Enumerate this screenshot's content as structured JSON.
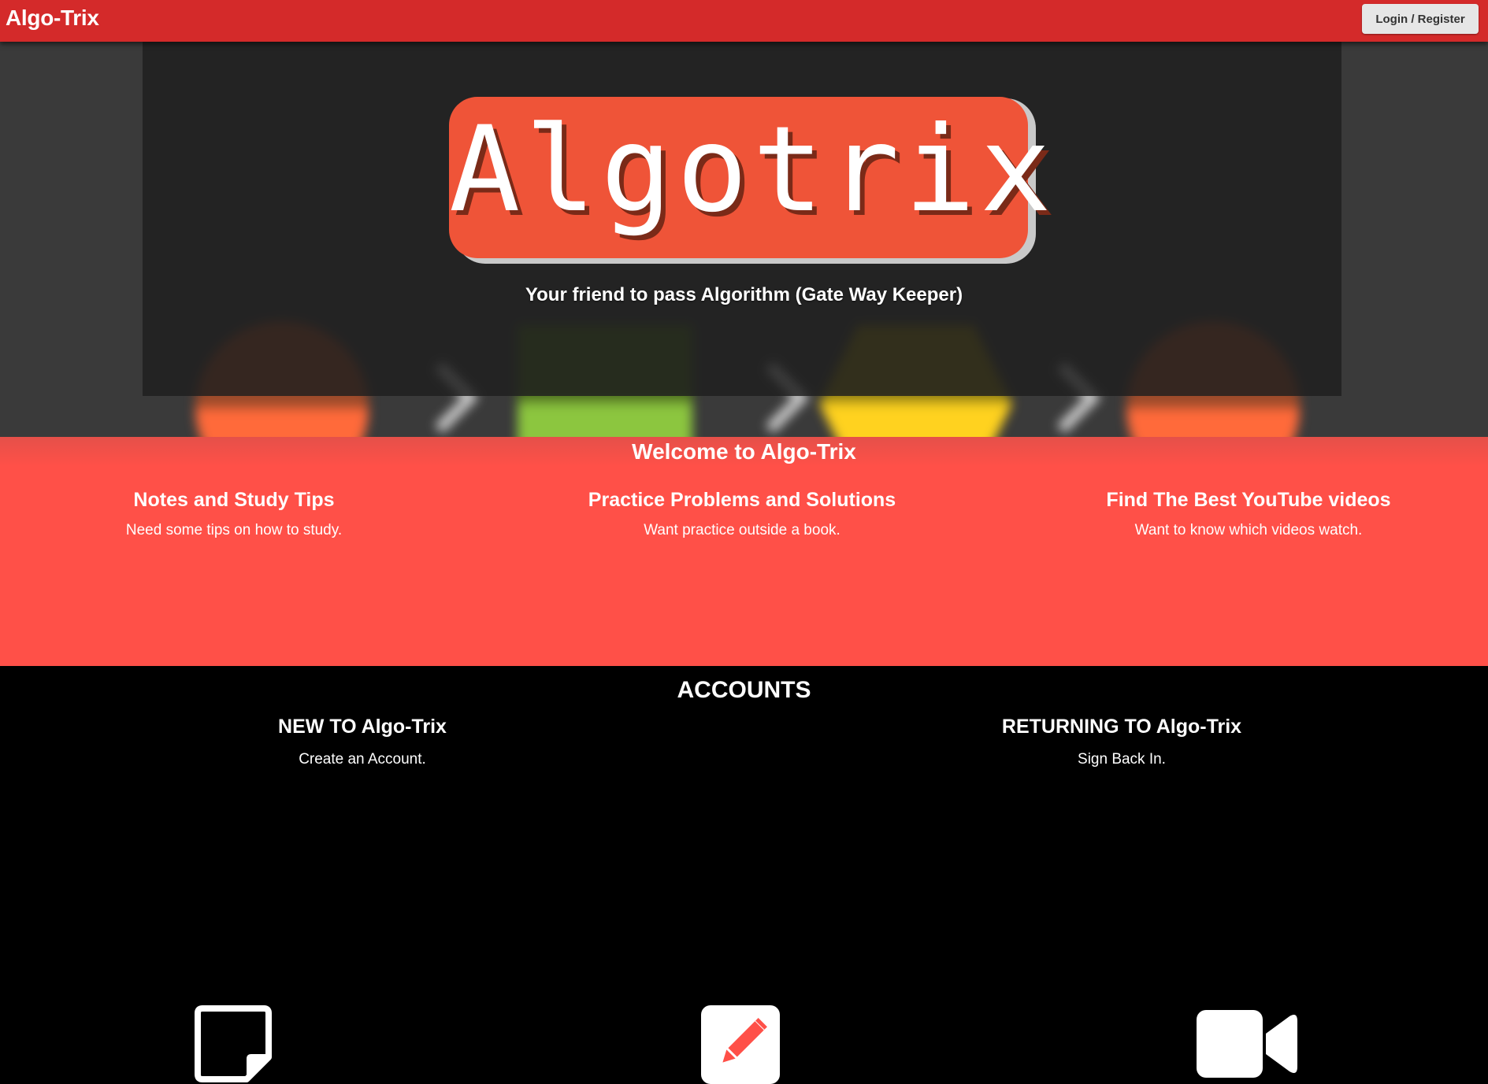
{
  "header": {
    "brand": "Algo-Trix",
    "login_label": "Login / Register"
  },
  "hero": {
    "logo_text": "Algotrix",
    "tagline": "Your friend to pass Algorithm (Gate Way Keeper)"
  },
  "features": {
    "heading": "Welcome to Algo-Trix",
    "items": [
      {
        "title": "Notes and Study Tips",
        "description": "Need some tips on how to study.",
        "icon": "sticky-note-icon"
      },
      {
        "title": "Practice Problems and Solutions",
        "description": "Want practice outside a book.",
        "icon": "pencil-square-icon"
      },
      {
        "title": "Find The Best YouTube videos",
        "description": "Want to know which videos watch.",
        "icon": "video-camera-icon"
      }
    ]
  },
  "accounts": {
    "heading": "ACCOUNTS",
    "new": {
      "title": "NEW TO Algo-Trix",
      "link": "Create an Account."
    },
    "returning": {
      "title": "RETURNING TO Algo-Trix",
      "link": "Sign Back In."
    }
  },
  "colors": {
    "navbar": "#d42a2a",
    "features_bg": "#ff5048",
    "logo_bg": "#ef5438",
    "accounts_bg": "#000000"
  }
}
